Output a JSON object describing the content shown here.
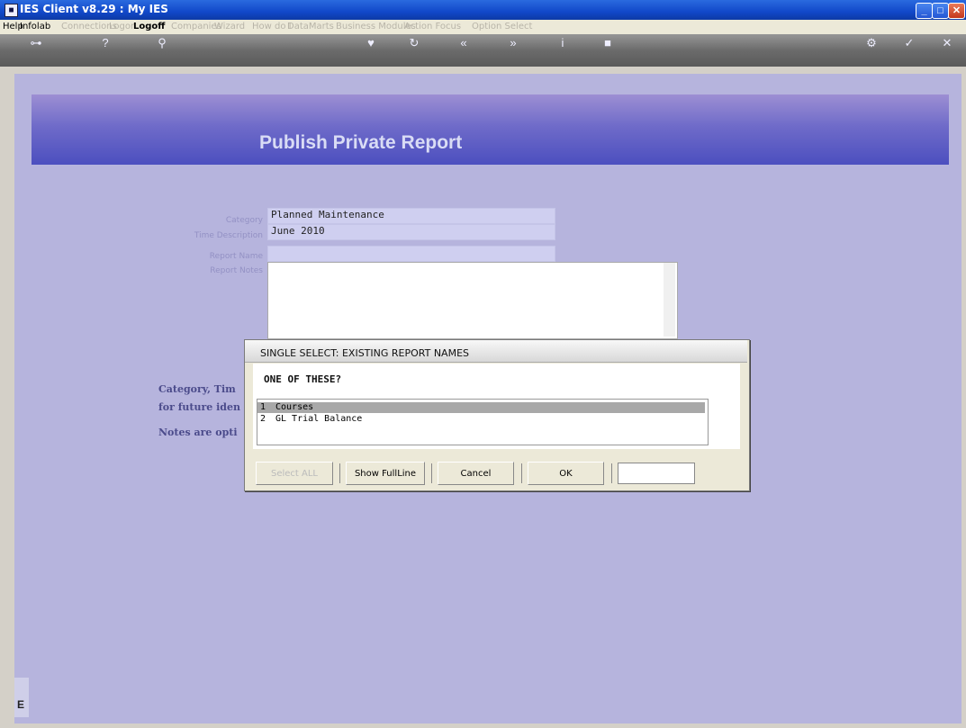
{
  "window": {
    "title": "IES Client v8.29 : My IES"
  },
  "menu": [
    {
      "label": "Help",
      "enabled": true
    },
    {
      "label": "Infolab",
      "enabled": true
    },
    {
      "label": "Connections",
      "enabled": false
    },
    {
      "label": "Logon",
      "enabled": false
    },
    {
      "label": "Logoff",
      "enabled": true
    },
    {
      "label": "Companies",
      "enabled": false
    },
    {
      "label": "Wizard",
      "enabled": false
    },
    {
      "label": "How do I",
      "enabled": false
    },
    {
      "label": "DataMarts",
      "enabled": false
    },
    {
      "label": "Business Modules",
      "enabled": false
    },
    {
      "label": "Action Focus",
      "enabled": false
    },
    {
      "label": "Option Select",
      "enabled": false
    }
  ],
  "toolbar": {
    "icons": [
      "key-icon",
      "help-icon",
      "search-icon",
      "heart-icon",
      "refresh-icon",
      "back-icon",
      "forward-icon",
      "info-icon",
      "square-icon",
      "settings-icon",
      "check-icon",
      "close-icon"
    ]
  },
  "banner": {
    "title": "Publish Private Report"
  },
  "form": {
    "labels": {
      "category": "Category",
      "time": "Time Description",
      "name": "Report Name",
      "notes": "Report Notes"
    },
    "values": {
      "category": "Planned Maintenance",
      "time": "June 2010",
      "name": "",
      "notes": ""
    }
  },
  "side_text": {
    "line1": "Category, Tim",
    "line2": "for future iden",
    "line3": "Notes are opti"
  },
  "dialog": {
    "title": "SINGLE SELECT: EXISTING REPORT NAMES",
    "prompt": "ONE OF THESE?",
    "items": [
      {
        "num": "1",
        "text": "Courses",
        "selected": true
      },
      {
        "num": "2",
        "text": "GL Trial Balance",
        "selected": false
      }
    ],
    "buttons": {
      "select_all": "Select ALL",
      "show_full": "Show FullLine",
      "cancel": "Cancel",
      "ok": "OK"
    }
  },
  "status": {
    "left_icon": "E"
  }
}
